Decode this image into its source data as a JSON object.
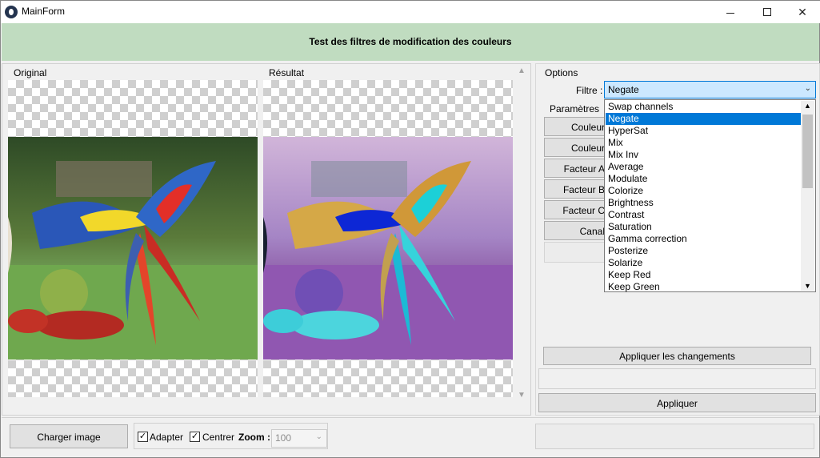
{
  "window": {
    "title": "MainForm"
  },
  "header": {
    "title": "Test des filtres de modification des couleurs"
  },
  "images": {
    "original_label": "Original",
    "result_label": "Résultat"
  },
  "options": {
    "group_label": "Options",
    "filter_label": "Filtre :",
    "filter_value": "Negate",
    "params_label": "Paramètres",
    "param_buttons": [
      "Couleur",
      "Couleur",
      "Facteur A",
      "Facteur B",
      "Facteur C",
      "Canal"
    ],
    "apply_changes_label": "Appliquer les changements",
    "apply_label": "Appliquer",
    "filter_options": [
      "Swap channels",
      "Negate",
      "HyperSat",
      "Mix",
      "Mix Inv",
      "Average",
      "Modulate",
      "Colorize",
      "Brightness",
      "Contrast",
      "Saturation",
      "Gamma correction",
      "Posterize",
      "Solarize",
      "Keep Red",
      "Keep Green"
    ],
    "selected_index": 1
  },
  "bottom": {
    "load_image_label": "Charger image",
    "adapt_label": "Adapter",
    "adapt_checked": true,
    "center_label": "Centrer",
    "center_checked": true,
    "zoom_label": "Zoom :",
    "zoom_value": "100"
  },
  "colors": {
    "header_bg": "#c0dcc0",
    "selection": "#0078d7"
  }
}
